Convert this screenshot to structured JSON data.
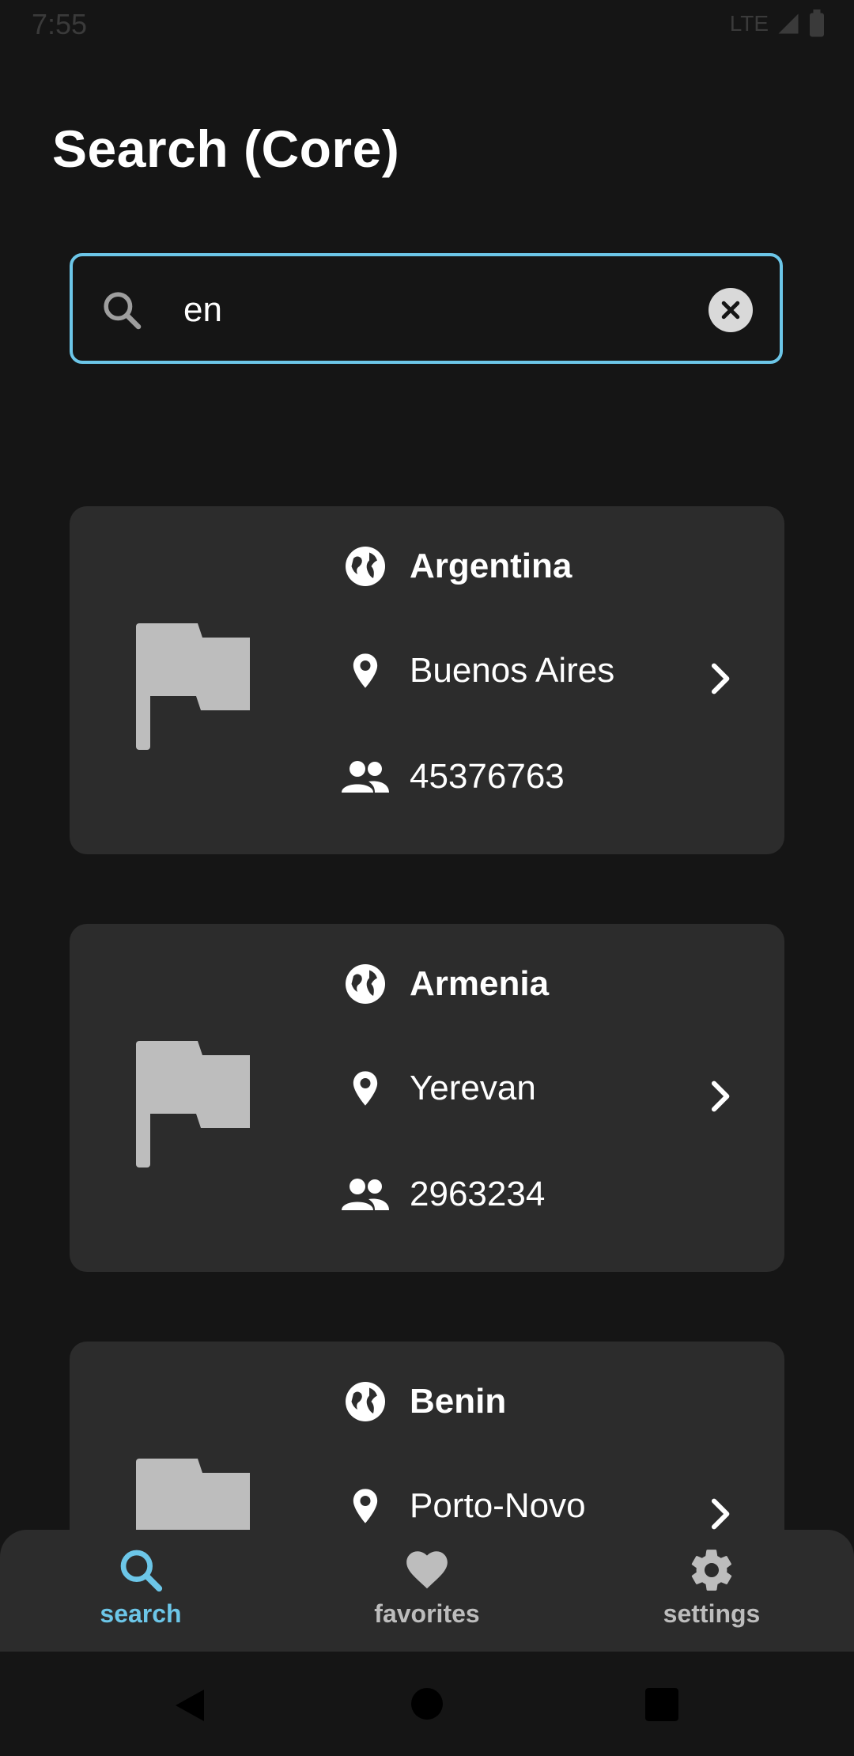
{
  "status_bar": {
    "time": "7:55",
    "network": "LTE"
  },
  "page": {
    "title": "Search (Core)"
  },
  "search": {
    "value": "en",
    "placeholder": ""
  },
  "results": [
    {
      "name": "Argentina",
      "capital": "Buenos Aires",
      "population": "45376763"
    },
    {
      "name": "Armenia",
      "capital": "Yerevan",
      "population": "2963234"
    },
    {
      "name": "Benin",
      "capital": "Porto-Novo",
      "population": ""
    }
  ],
  "bottom_nav": {
    "items": [
      {
        "label": "search",
        "icon": "search-icon",
        "active": true
      },
      {
        "label": "favorites",
        "icon": "heart-icon",
        "active": false
      },
      {
        "label": "settings",
        "icon": "gear-icon",
        "active": false
      }
    ]
  },
  "colors": {
    "background": "#151515",
    "card": "#2c2c2c",
    "accent": "#6cc6e8",
    "inactive": "#bdbdbd",
    "flag": "#bdbdbd"
  }
}
